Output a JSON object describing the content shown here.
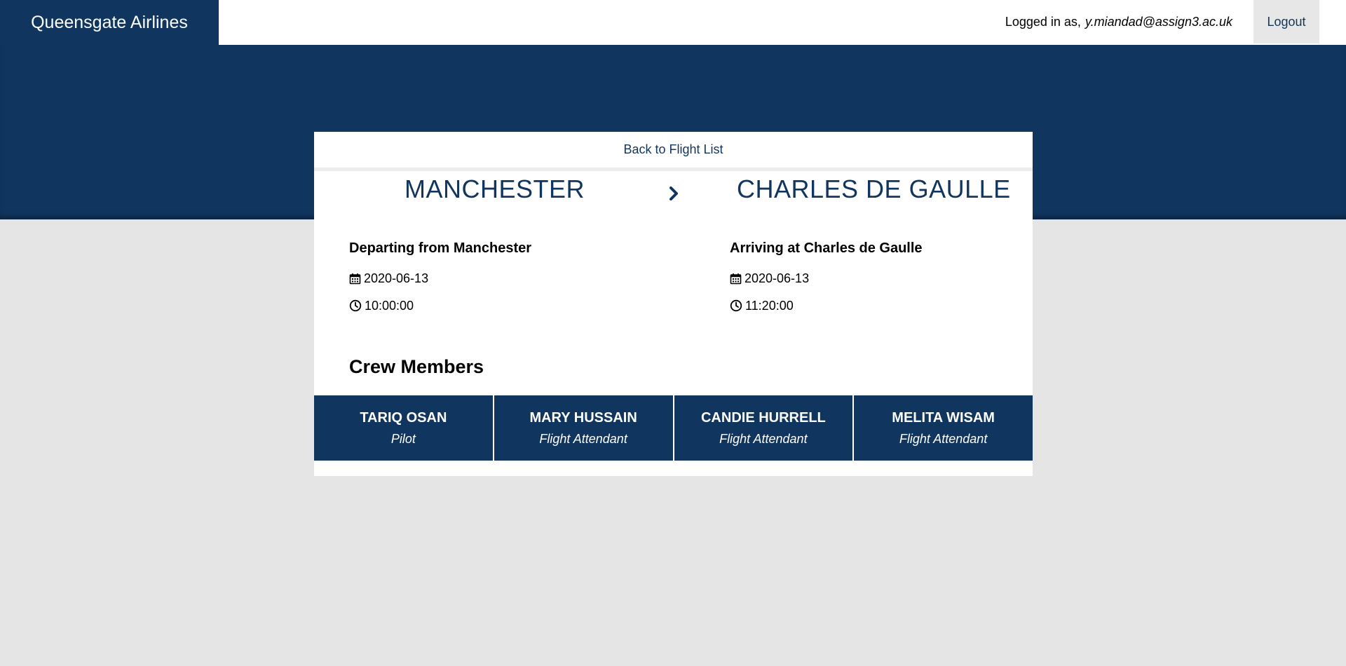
{
  "header": {
    "brand": "Queensgate Airlines",
    "logged_in_prefix": "Logged in as,",
    "user_email": "y.miandad@assign3.ac.uk",
    "logout_label": "Logout"
  },
  "flight": {
    "back_label": "Back to Flight List",
    "origin_city": "MANCHESTER",
    "destination_city": "CHARLES DE GAULLE",
    "departure": {
      "title": "Departing from Manchester",
      "date": "2020-06-13",
      "time": "10:00:00"
    },
    "arrival": {
      "title": "Arriving at Charles de Gaulle",
      "date": "2020-06-13",
      "time": "11:20:00"
    }
  },
  "crew": {
    "heading": "Crew Members",
    "members": [
      {
        "name": "TARIQ OSAN",
        "role": "Pilot"
      },
      {
        "name": "MARY HUSSAIN",
        "role": "Flight Attendant"
      },
      {
        "name": "CANDIE HURRELL",
        "role": "Flight Attendant"
      },
      {
        "name": "MELITA WISAM",
        "role": "Flight Attendant"
      }
    ]
  },
  "colors": {
    "brand_navy": "#10355f",
    "page_background": "#e5e5e5"
  }
}
